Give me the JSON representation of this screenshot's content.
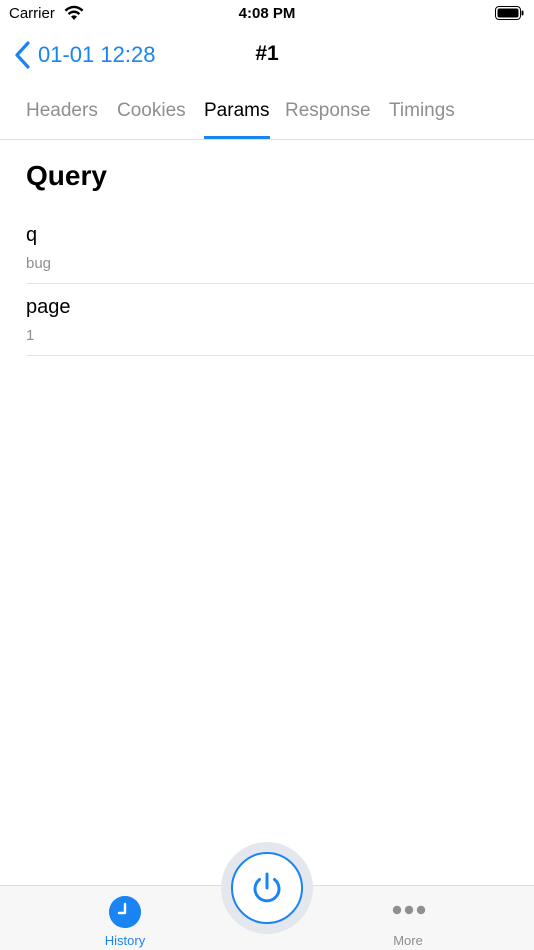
{
  "status_bar": {
    "carrier": "Carrier",
    "time": "4:08 PM"
  },
  "nav": {
    "back_label": "01-01 12:28",
    "title": "#1"
  },
  "tabs": [
    {
      "label": "Headers",
      "active": false
    },
    {
      "label": "Cookies",
      "active": false
    },
    {
      "label": "Params",
      "active": true
    },
    {
      "label": "Response",
      "active": false
    },
    {
      "label": "Timings",
      "active": false
    }
  ],
  "section": {
    "title": "Query",
    "params": [
      {
        "key": "q",
        "value": "bug"
      },
      {
        "key": "page",
        "value": "1"
      }
    ]
  },
  "tabbar": {
    "history": {
      "label": "History",
      "icon": "clock-icon",
      "active": true
    },
    "more": {
      "label": "More",
      "icon": "ellipsis-icon",
      "active": false
    },
    "center": {
      "icon": "power-icon"
    }
  },
  "colors": {
    "accent": "#1a84f5",
    "secondary_text": "#8e8e93",
    "separator": "#e3e3e3"
  }
}
